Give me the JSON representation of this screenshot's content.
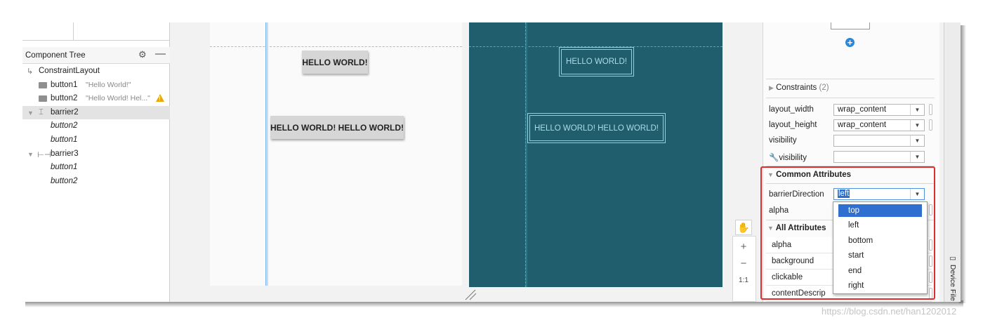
{
  "component_tree": {
    "title": "Component Tree",
    "items": [
      {
        "label": "ConstraintLayout"
      },
      {
        "label": "button1",
        "sub": "\"Hello World!\""
      },
      {
        "label": "button2",
        "sub": "\"Hello World! Hel...\""
      },
      {
        "label": "barrier2"
      },
      {
        "label": "button2"
      },
      {
        "label": "button1"
      },
      {
        "label": "barrier3"
      },
      {
        "label": "button1"
      },
      {
        "label": "button2"
      }
    ]
  },
  "design": {
    "button1": "HELLO WORLD!",
    "button2": "HELLO WORLD! HELLO WORLD!"
  },
  "blueprint": {
    "button1": "HELLO WORLD!",
    "button2": "HELLO WORLD! HELLO WORLD!"
  },
  "zoom": {
    "plus": "+",
    "minus": "−",
    "one_to_one": "1:1"
  },
  "attributes": {
    "constraints_label": "Constraints",
    "constraints_count": "(2)",
    "layout_width_label": "layout_width",
    "layout_width_value": "wrap_content",
    "layout_height_label": "layout_height",
    "layout_height_value": "wrap_content",
    "visibility_label": "visibility",
    "tool_visibility_label": "visibility",
    "common_title": "Common Attributes",
    "barrier_direction_label": "barrierDirection",
    "barrier_direction_value": "left",
    "alpha_label": "alpha",
    "all_title": "All Attributes",
    "all_rows": [
      "alpha",
      "background",
      "clickable",
      "contentDescrip"
    ]
  },
  "dropdown": {
    "options": [
      "top",
      "left",
      "bottom",
      "start",
      "end",
      "right"
    ],
    "selected": "top"
  },
  "sidebar": {
    "device_file": "Device File"
  },
  "watermark": "https://blog.csdn.net/han1202012"
}
